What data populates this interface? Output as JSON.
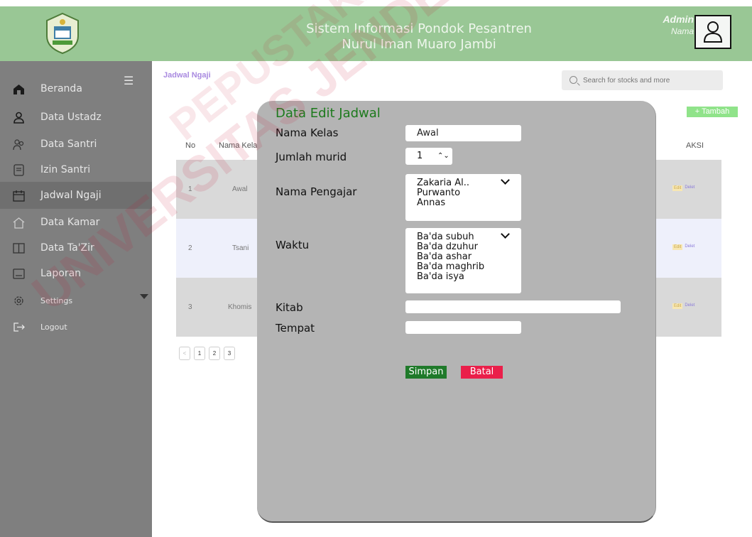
{
  "header": {
    "title_line1": "Sistem Informasi Pondok Pesantren",
    "title_line2": "Nurul Iman Muaro Jambi",
    "user_role": "Admin",
    "user_name": "Nama"
  },
  "sidebar": {
    "items": [
      {
        "label": "Beranda",
        "icon": "home-icon"
      },
      {
        "label": "Data Ustadz",
        "icon": "user-icon"
      },
      {
        "label": "Data Santri",
        "icon": "users-icon"
      },
      {
        "label": "Izin Santri",
        "icon": "document-icon"
      },
      {
        "label": "Jadwal Ngaji",
        "icon": "calendar-icon"
      },
      {
        "label": "Data Kamar",
        "icon": "house-icon"
      },
      {
        "label": "Data Ta'Zir",
        "icon": "book-icon"
      },
      {
        "label": "Laporan",
        "icon": "report-icon"
      },
      {
        "label": "Settings",
        "icon": "gear-icon"
      },
      {
        "label": "Logout",
        "icon": "logout-icon"
      }
    ]
  },
  "main": {
    "breadcrumb": "Jadwal Ngaji",
    "search_placeholder": "Search for stocks and more",
    "add_button": "+ Tambah",
    "table": {
      "headers": {
        "no": "No",
        "nama_kelas": "Nama Kela",
        "aksi": "AKSI"
      },
      "rows": [
        {
          "no": "1",
          "kelas": "Awal"
        },
        {
          "no": "2",
          "kelas": "Tsani"
        },
        {
          "no": "3",
          "kelas": "Khomis"
        }
      ],
      "edit_label": "Edit",
      "delete_label": "Delet"
    },
    "pagination": [
      "<",
      "1",
      "2",
      "3"
    ]
  },
  "modal": {
    "title": "Data Edit Jadwal",
    "labels": {
      "nama_kelas": "Nama Kelas",
      "jumlah_murid": "Jumlah murid",
      "nama_pengajar": "Nama Pengajar",
      "waktu": "Waktu",
      "kitab": "Kitab",
      "tempat": "Tempat"
    },
    "values": {
      "nama_kelas": "Awal",
      "jumlah_murid": "1",
      "kitab": "",
      "tempat": ""
    },
    "pengajar_options": [
      "Zakaria Al..",
      "Purwanto",
      "Annas"
    ],
    "waktu_options": [
      "Ba'da subuh",
      "Ba'da dzuhur",
      "Ba'da ashar",
      "Ba'da maghrib",
      "Ba'da isya"
    ],
    "save_label": "Simpan",
    "cancel_label": "Batal"
  },
  "watermark": {
    "line1": "UNIVERSITAS JENDERAL",
    "line2": "PEPUSTAKAAN YOGYAKARTA"
  },
  "colors": {
    "header_bg": "#99c795",
    "sidebar_bg": "#7f7f7f",
    "modal_bg": "#b4b4b4",
    "title_green": "#1d7a1d",
    "save_green": "#1f7a2a",
    "cancel_red": "#ea1f4a",
    "accent_purple": "#a98ae0"
  }
}
